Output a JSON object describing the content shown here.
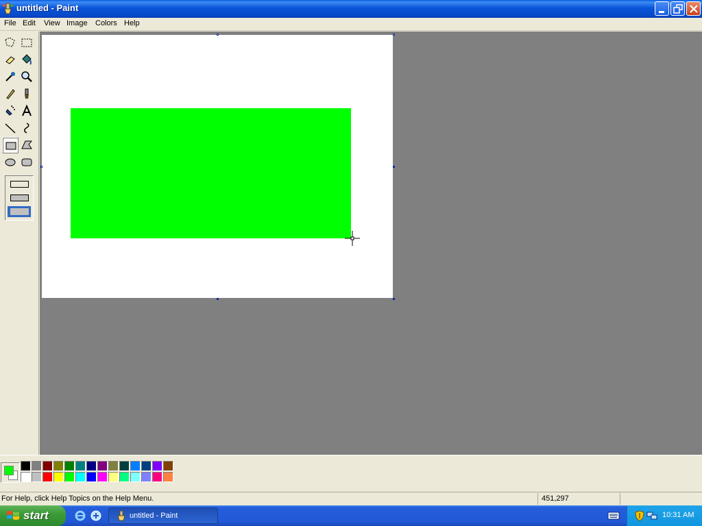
{
  "window": {
    "title": "untitled - Paint",
    "controls": [
      "minimize",
      "restore",
      "close"
    ]
  },
  "menu": {
    "items": [
      "File",
      "Edit",
      "View",
      "Image",
      "Colors",
      "Help"
    ]
  },
  "toolbox": {
    "tools": [
      {
        "name": "free-form-select-icon"
      },
      {
        "name": "select-icon"
      },
      {
        "name": "eraser-icon"
      },
      {
        "name": "fill-with-color-icon"
      },
      {
        "name": "pick-color-icon"
      },
      {
        "name": "magnifier-icon"
      },
      {
        "name": "pencil-icon"
      },
      {
        "name": "brush-icon"
      },
      {
        "name": "airbrush-icon"
      },
      {
        "name": "text-icon"
      },
      {
        "name": "line-icon"
      },
      {
        "name": "curve-icon"
      },
      {
        "name": "rectangle-icon",
        "selected": true
      },
      {
        "name": "polygon-icon"
      },
      {
        "name": "ellipse-icon"
      },
      {
        "name": "rounded-rectangle-icon"
      }
    ],
    "fill_options": [
      "outline",
      "outline-and-fill",
      "fill-only"
    ],
    "selected_fill_option": "fill-only"
  },
  "canvas": {
    "background": "#ffffff",
    "shape_fill": "#00ff00"
  },
  "palette": {
    "foreground": "#00ff00",
    "background": "#ffffff",
    "top_row": [
      "#000000",
      "#808080",
      "#800000",
      "#808000",
      "#008000",
      "#008080",
      "#000080",
      "#800080",
      "#808040",
      "#004040",
      "#0080ff",
      "#004080",
      "#8000ff",
      "#804000"
    ],
    "bottom_row": [
      "#ffffff",
      "#c0c0c0",
      "#ff0000",
      "#ffff00",
      "#00ff00",
      "#00ffff",
      "#0000ff",
      "#ff00ff",
      "#ffff80",
      "#00ff80",
      "#80ffff",
      "#8080ff",
      "#ff0080",
      "#ff8040"
    ]
  },
  "status": {
    "help_text": "For Help, click Help Topics on the Help Menu.",
    "coords": "451,297"
  },
  "taskbar": {
    "start_label": "start",
    "task_label": "untitled - Paint",
    "clock": "10:31 AM"
  }
}
